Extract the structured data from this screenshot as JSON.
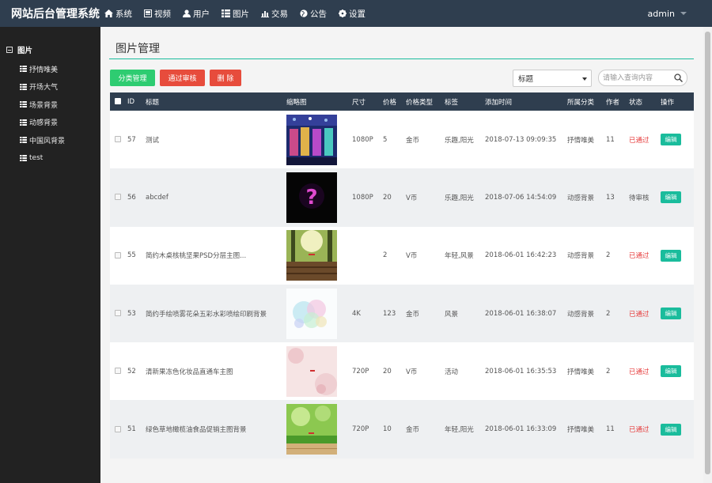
{
  "brand": "网站后台管理系统",
  "nav": [
    {
      "label": "系统",
      "icon": "home-icon"
    },
    {
      "label": "视频",
      "icon": "video-icon"
    },
    {
      "label": "用户",
      "icon": "user-icon"
    },
    {
      "label": "图片",
      "icon": "list-icon"
    },
    {
      "label": "交易",
      "icon": "bar-chart-icon"
    },
    {
      "label": "公告",
      "icon": "globe-icon"
    },
    {
      "label": "设置",
      "icon": "gear-icon"
    }
  ],
  "user": {
    "name": "admin"
  },
  "sidebar": {
    "root": "图片",
    "items": [
      {
        "label": "抒情唯美"
      },
      {
        "label": "开场大气"
      },
      {
        "label": "场景背景"
      },
      {
        "label": "动感背景"
      },
      {
        "label": "中国风背景"
      },
      {
        "label": "test"
      }
    ]
  },
  "main": {
    "title": "图片管理",
    "buttons": {
      "category": "分类管理",
      "approve": "通过审核",
      "delete": "删 除"
    },
    "filter": {
      "selected": "标题"
    },
    "search": {
      "placeholder": "请输入查询内容"
    }
  },
  "table": {
    "headers": [
      "ID",
      "标题",
      "缩略图",
      "尺寸",
      "价格",
      "价格类型",
      "标签",
      "添加时间",
      "所属分类",
      "作者",
      "状态",
      "操作"
    ],
    "rows": [
      {
        "id": "57",
        "title": "测试",
        "size": "1080P",
        "price": "5",
        "price_type": "金币",
        "tags": "乐趣,阳光",
        "added": "2018-07-13 09:09:35",
        "category": "抒情唯美",
        "author": "11",
        "status": "已通过",
        "action": "编辑"
      },
      {
        "id": "56",
        "title": "abcdef",
        "size": "1080P",
        "price": "20",
        "price_type": "V币",
        "tags": "乐趣,阳光",
        "added": "2018-07-06 14:54:09",
        "category": "动感背景",
        "author": "13",
        "status": "待审核",
        "action": "编辑"
      },
      {
        "id": "55",
        "title": "简约木桌核桃坚果PSD分层主图...",
        "size": "",
        "price": "2",
        "price_type": "V币",
        "tags": "年轻,风景",
        "added": "2018-06-01 16:42:23",
        "category": "动感背景",
        "author": "2",
        "status": "已通过",
        "action": "编辑"
      },
      {
        "id": "53",
        "title": "简约手绘喷雾花朵五彩水彩喷绘印刷背景",
        "size": "4K",
        "price": "123",
        "price_type": "金币",
        "tags": "风景",
        "added": "2018-06-01 16:38:07",
        "category": "动感背景",
        "author": "2",
        "status": "已通过",
        "action": "编辑"
      },
      {
        "id": "52",
        "title": "清新果冻色化妆品直通车主图",
        "size": "720P",
        "price": "20",
        "price_type": "V币",
        "tags": "活动",
        "added": "2018-06-01 16:35:53",
        "category": "抒情唯美",
        "author": "2",
        "status": "已通过",
        "action": "编辑"
      },
      {
        "id": "51",
        "title": "绿色草地橄榄油食品促销主图背景",
        "size": "720P",
        "price": "10",
        "price_type": "金币",
        "tags": "年轻,阳光",
        "added": "2018-06-01 16:33:09",
        "category": "抒情唯美",
        "author": "11",
        "status": "已通过",
        "action": "编辑"
      }
    ]
  }
}
